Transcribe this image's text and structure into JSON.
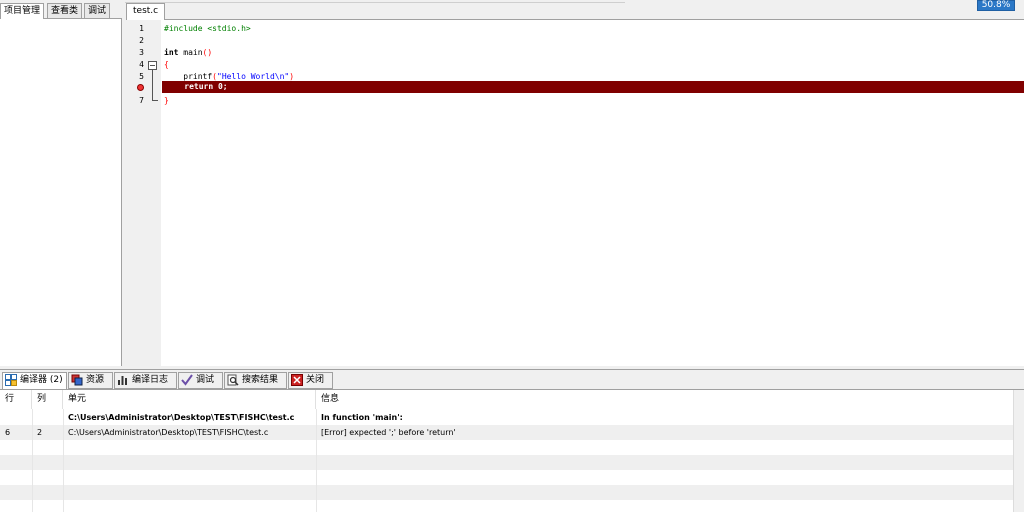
{
  "window": {
    "zoom": "50.8%"
  },
  "left_panel": {
    "tabs": [
      {
        "label": "项目管理"
      },
      {
        "label": "查看类"
      },
      {
        "label": "调试"
      }
    ]
  },
  "editor": {
    "tab": "test.c",
    "line_numbers": [
      "1",
      "2",
      "3",
      "4",
      "5",
      "",
      "7"
    ],
    "lines": {
      "include": "#include <stdio.h>",
      "int_kw": "int",
      "main_rest": " main",
      "main_paren": "()",
      "open_brace": "{",
      "printf_fn": "printf",
      "printf_open": "(",
      "printf_str": "\"Hello World\\n\"",
      "printf_close": ")",
      "return_line": "return 0;",
      "close_brace": "}"
    },
    "error_line_color": "#800000"
  },
  "bottom_tabs": [
    {
      "label": "编译器 (2)",
      "icon": "grid-icon"
    },
    {
      "label": "资源",
      "icon": "resource-icon"
    },
    {
      "label": "编译日志",
      "icon": "bar-chart-icon"
    },
    {
      "label": "调试",
      "icon": "check-icon"
    },
    {
      "label": "搜索结果",
      "icon": "search-icon"
    },
    {
      "label": "关闭",
      "icon": "close-icon"
    }
  ],
  "results": {
    "headers": {
      "row": "行",
      "col": "列",
      "unit": "单元",
      "info": "信息"
    },
    "rows": [
      {
        "row": "",
        "col": "",
        "unit": "C:\\Users\\Administrator\\Desktop\\TEST\\FISHC\\test.c",
        "info": "In function 'main':"
      },
      {
        "row": "6",
        "col": "2",
        "unit": "C:\\Users\\Administrator\\Desktop\\TEST\\FISHC\\test.c",
        "info": "[Error] expected ';' before 'return'"
      }
    ]
  }
}
